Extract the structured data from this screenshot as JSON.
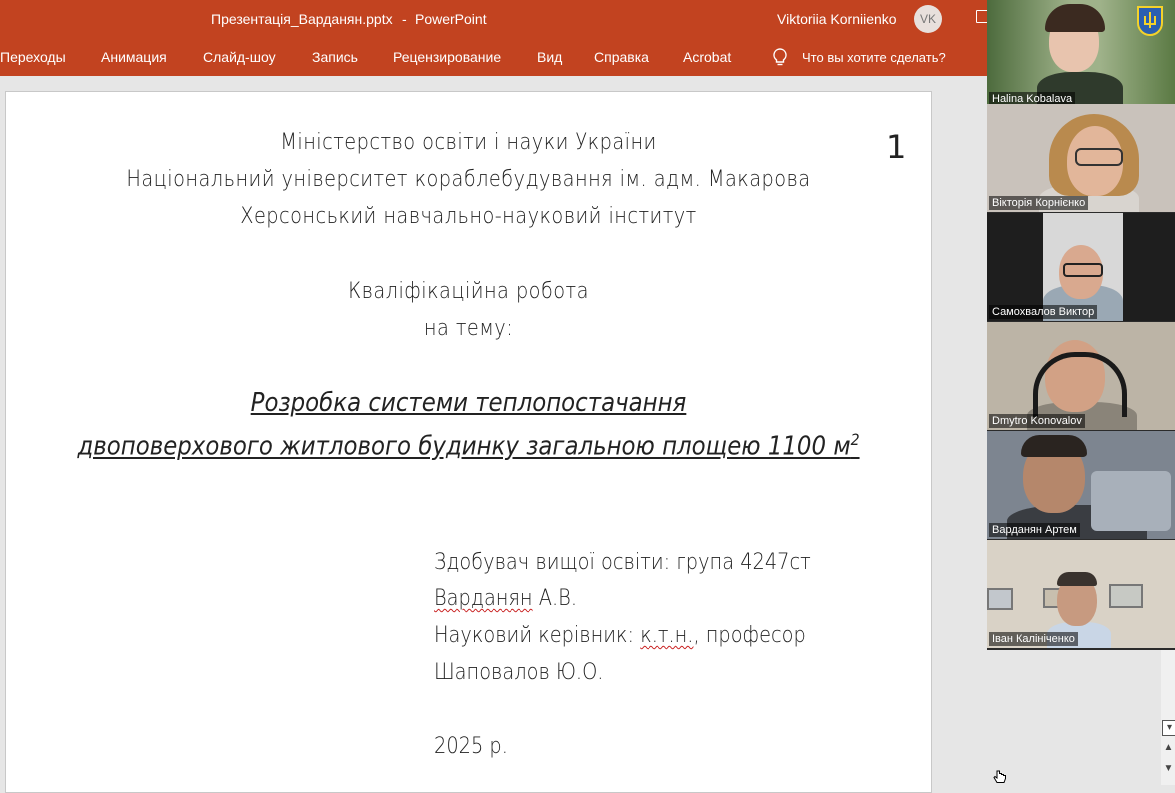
{
  "titlebar": {
    "document_title": "Презентація_Варданян.pptx",
    "separator": "-",
    "app_name": "PowerPoint",
    "user_name": "Viktoriia Korniienko",
    "user_initials": "VK"
  },
  "ribbon": {
    "tabs": [
      "Переходы",
      "Анимация",
      "Слайд-шоу",
      "Запись",
      "Рецензирование",
      "Вид",
      "Справка",
      "Acrobat"
    ],
    "tell_me": "Что вы хотите сделать?"
  },
  "slide": {
    "number": "1",
    "header_lines": [
      "Міністерство освіти і науки України",
      "Національний університет кораблебудування ім. адм. Макарова",
      "Херсонський навчально-науковий інститут"
    ],
    "work_type": "Кваліфікаційна робота",
    "on_topic": "на тему:",
    "topic_line1": "Розробка системи теплопостачання",
    "topic_line2": "двоповерхового житлового будинку загальною площею 1100 м",
    "topic_sup": "2",
    "student_line": "Здобувач вищої освіти: група 4247ст",
    "student_surname": "Варданян",
    "student_initials": "А.В.",
    "supervisor_prefix": "Науковий керівник: ",
    "supervisor_degree": "к.т.н.",
    "supervisor_title": ", професор",
    "supervisor_name": "Шаповалов Ю.О.",
    "year": "2025 р."
  },
  "participants": [
    {
      "name": "Halina Kobalava"
    },
    {
      "name": "Вікторія Корнієнко"
    },
    {
      "name": "Самохвалов Виктор"
    },
    {
      "name": "Dmytro Konovalov"
    },
    {
      "name": "Варданян Артем"
    },
    {
      "name": "Іван Калініченко"
    }
  ],
  "colors": {
    "ribbon": "#c24320",
    "slide_background": "#ffffff",
    "workspace": "#e6e6e6"
  }
}
